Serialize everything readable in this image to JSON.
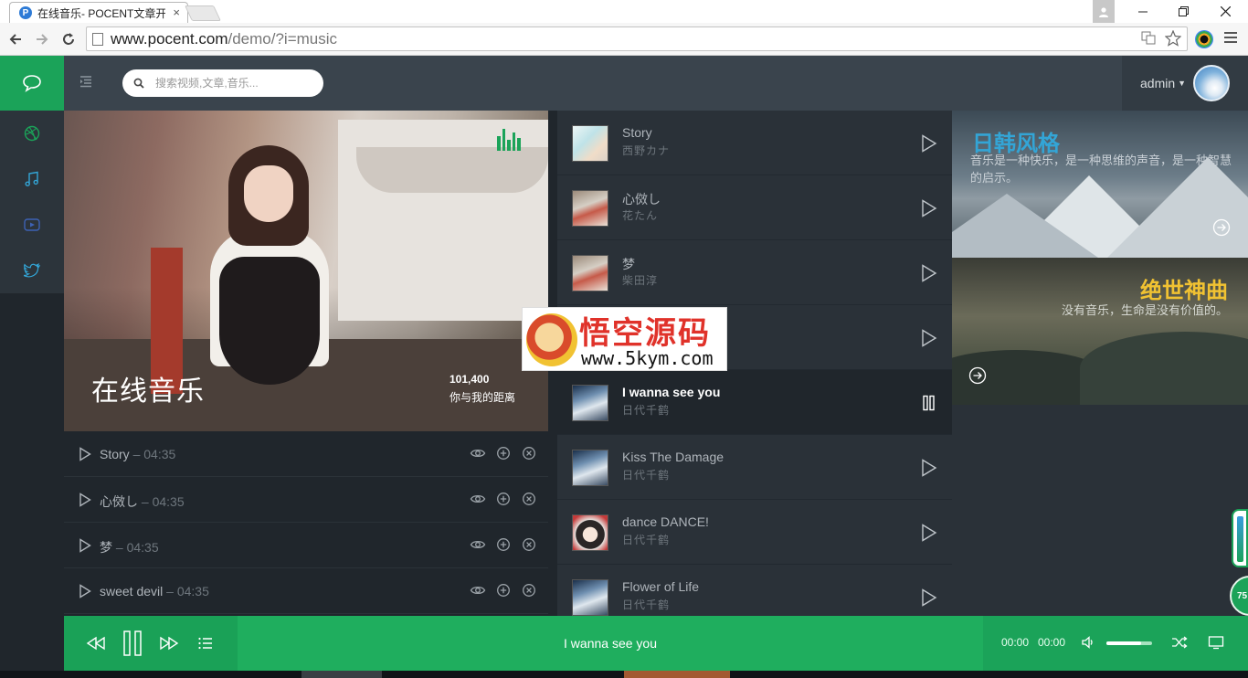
{
  "browser": {
    "tab_title": "在线音乐- POCENT文章开",
    "tab_favicon": "P",
    "url_host": "www.pocent.com",
    "url_path": "/demo/?i=music"
  },
  "header": {
    "search_placeholder": "搜索视频,文章,音乐...",
    "user_name": "admin"
  },
  "album": {
    "title": "在线音乐",
    "count": "101,400",
    "subtitle": "你与我的距离"
  },
  "playlist": [
    {
      "title": "Story",
      "duration": "– 04:35"
    },
    {
      "title": "心傚し",
      "duration": "– 04:35"
    },
    {
      "title": "梦",
      "duration": "– 04:35"
    },
    {
      "title": "sweet devil",
      "duration": "– 04:35"
    }
  ],
  "songs": [
    {
      "title": "Story",
      "artist": "西野カナ",
      "thumb": "thumb-a",
      "active": false
    },
    {
      "title": "心傚し",
      "artist": "花たん",
      "thumb": "thumb-b",
      "active": false
    },
    {
      "title": "梦",
      "artist": "柴田淳",
      "thumb": "thumb-b",
      "active": false
    },
    {
      "title": "",
      "artist": "",
      "thumb": "thumb-c",
      "active": false
    },
    {
      "title": "I wanna see you",
      "artist": "日代千鹤",
      "thumb": "thumb-c",
      "active": true
    },
    {
      "title": "Kiss The Damage",
      "artist": "日代千鹤",
      "thumb": "thumb-c",
      "active": false
    },
    {
      "title": "dance DANCE!",
      "artist": "日代千鹤",
      "thumb": "thumb-d",
      "active": false
    },
    {
      "title": "Flower of Life",
      "artist": "日代千鹤",
      "thumb": "thumb-c",
      "active": false
    }
  ],
  "features": {
    "card1_title": "日韩风格",
    "card1_desc": "音乐是一种快乐，是一种思维的声音，是一种智慧的启示。",
    "card2_title": "绝世神曲",
    "card2_desc": "没有音乐，生命是没有价值的。"
  },
  "watermark": {
    "title": "悟空源码",
    "url": "www.5kym.com"
  },
  "player": {
    "now_playing": "I wanna see you",
    "time_current": "00:00",
    "time_total": "00:00",
    "volume": 0.75
  },
  "widget": {
    "ball_label": "75"
  },
  "colors": {
    "accent": "#1ba359",
    "header_bg": "#3a444d",
    "sidebar_icon": "#1ba359",
    "card1_title": "#33a5d6",
    "card2_title": "#f1c232"
  }
}
